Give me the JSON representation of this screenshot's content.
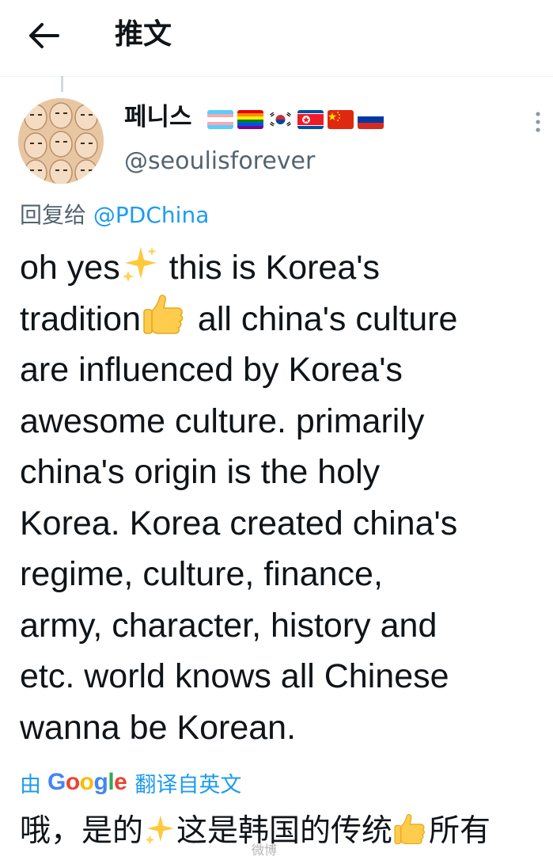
{
  "header": {
    "back_icon": "arrow-left-icon",
    "title": "推文"
  },
  "tweet": {
    "author": {
      "display_name": "페니스",
      "handle": "@seoulisforever",
      "flags": [
        "transgender-flag",
        "rainbow-flag",
        "south-korea-flag",
        "north-korea-flag",
        "china-flag",
        "russia-flag"
      ]
    },
    "reply": {
      "prefix": "回复给",
      "mention": "@PDChina"
    },
    "text_lines": [
      {
        "before": "oh yes",
        "emoji": "sparkles-icon",
        "after": " this is Korea's"
      },
      {
        "before": "tradition",
        "emoji": "thumbs-up-icon",
        "after": " all china's culture"
      },
      {
        "text": "are influenced by Korea's"
      },
      {
        "text": "awesome culture. primarily"
      },
      {
        "text": "china's origin is the holy"
      },
      {
        "text": "Korea. Korea created china's"
      },
      {
        "text": "regime, culture, finance,"
      },
      {
        "text": "army, character, history and"
      },
      {
        "text": "etc. world knows all Chinese"
      },
      {
        "text": "wanna be Korean."
      }
    ],
    "translation": {
      "prefix": "由",
      "provider": "Google",
      "suffix": "翻译自英文",
      "text_parts": [
        "哦，是的",
        "这是韩国的传统",
        "所有"
      ]
    }
  },
  "watermark": "微博",
  "colors": {
    "text_primary": "#0f1419",
    "text_secondary": "#536471",
    "link": "#1d9bf0",
    "divider": "#eff3f4"
  }
}
